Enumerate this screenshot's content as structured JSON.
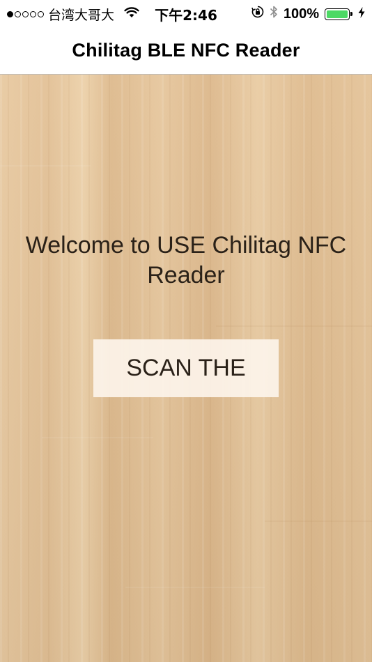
{
  "status_bar": {
    "carrier": "台湾大哥大",
    "time": "下午2:46",
    "battery_percent": "100%",
    "battery_level": 1.0,
    "battery_color": "#4cd964",
    "icons": [
      "signal-dots-icon",
      "wifi-icon",
      "orientation-lock-icon",
      "bluetooth-icon",
      "battery-icon",
      "charging-icon"
    ]
  },
  "nav": {
    "title": "Chilitag BLE NFC Reader"
  },
  "main": {
    "welcome_text": "Welcome to USE Chilitag NFC Reader",
    "scan_button_label": "SCAN THE"
  },
  "colors": {
    "text_dark": "#2a2118",
    "nav_background": "#ffffff",
    "button_background": "#fdf5ec"
  }
}
